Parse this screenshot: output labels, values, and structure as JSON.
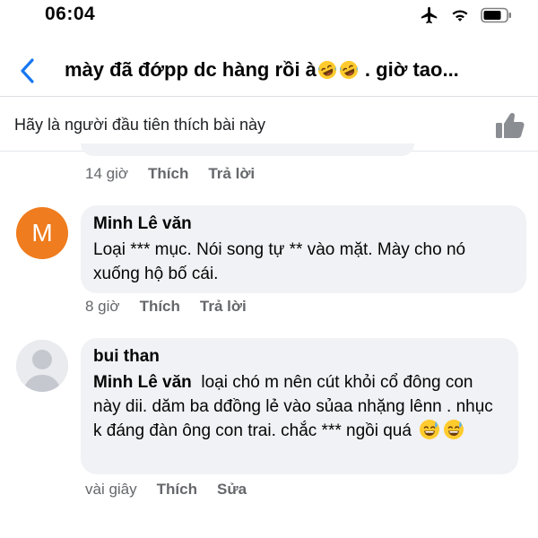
{
  "status_bar": {
    "time": "06:04",
    "icons": [
      "airplane-icon",
      "wifi-icon",
      "battery-icon"
    ]
  },
  "header": {
    "title_before": "mày đã đớpp dc hàng rồi à",
    "title_after": ". giờ tao...",
    "title_emojis": [
      "rofl-emoji",
      "rofl-emoji"
    ]
  },
  "like_bar": {
    "text": "Hãy là người đầu tiên thích bài này"
  },
  "previous_comment_meta": {
    "time": "14 giờ",
    "like": "Thích",
    "reply": "Trả lời"
  },
  "comments": [
    {
      "author": "Minh Lê văn",
      "avatar_letter": "M",
      "avatar_color": "#ef7c1e",
      "text": "Loại *** mục. Nói song tự ** vào mặt. Mày cho nó xuống hộ bố cái.",
      "time": "8 giờ",
      "like": "Thích",
      "reply": "Trả lời"
    },
    {
      "author": "bui than",
      "mention": "Minh Lê văn",
      "text": "loại chó m nên cút khỏi cổ đông con này dii. dăm ba dđồng lẻ vào sủaa nhặng lênn . nhục k đáng đàn ông con trai. chắc *** ngồi quá",
      "emojis": [
        "sweat-smile-emoji",
        "sweat-smile-emoji"
      ],
      "time": "vài giây",
      "like": "Thích",
      "edit": "Sửa"
    }
  ],
  "colors": {
    "bubble": "#f0f2f5",
    "meta_text": "#65676b",
    "back_arrow": "#1877f2"
  }
}
